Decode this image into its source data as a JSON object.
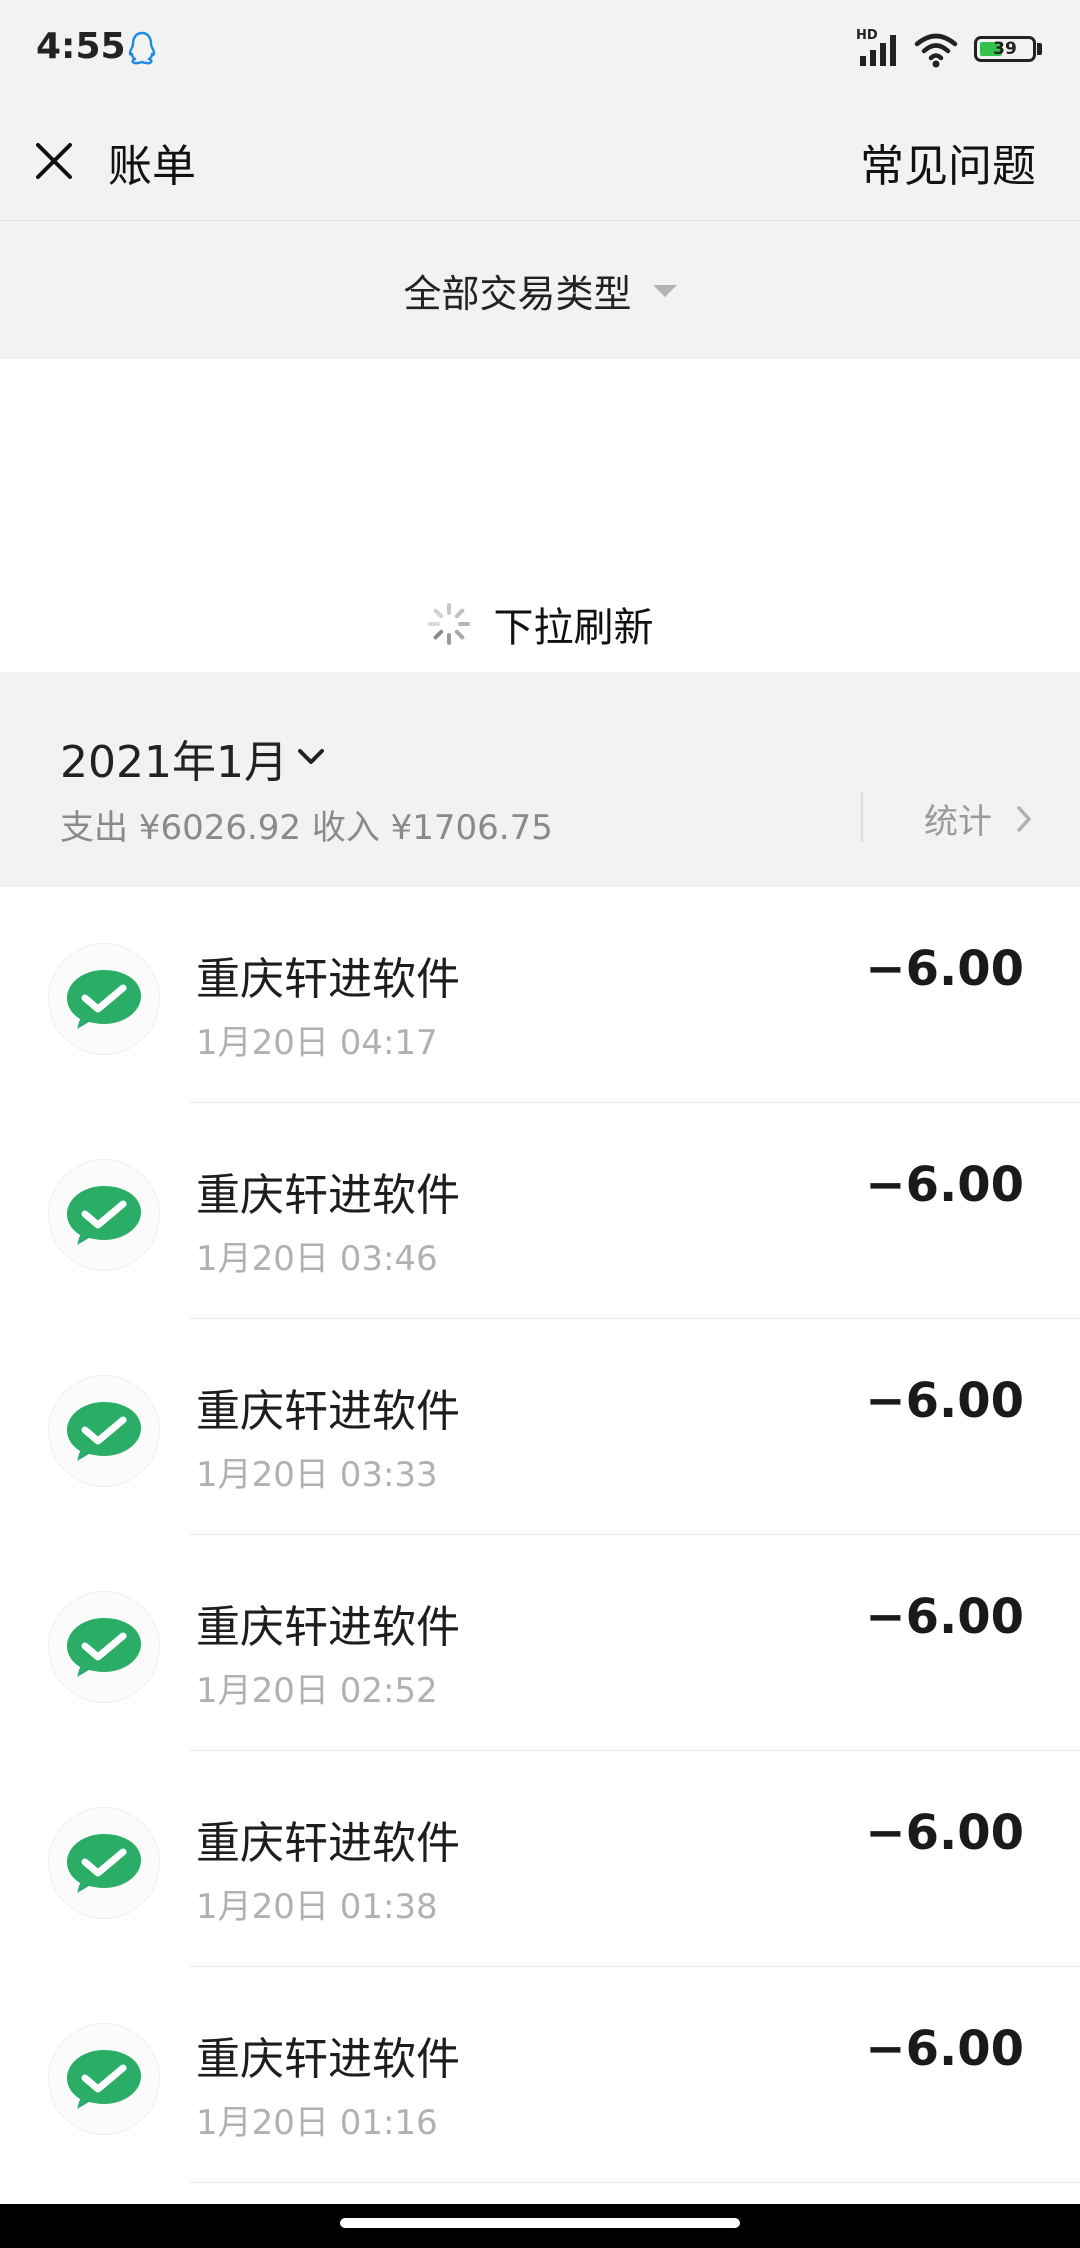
{
  "status_bar": {
    "time": "4:55",
    "hd_label": "HD",
    "battery": "39",
    "battery_level": 0.39,
    "battery_color": "#33c24d",
    "icons": [
      "qq-icon",
      "signal-icon",
      "wifi-icon",
      "battery-icon"
    ]
  },
  "header": {
    "title": "账单",
    "faq_label": "常见问题",
    "close_icon": "close-icon"
  },
  "filter": {
    "label": "全部交易类型",
    "caret_icon": "caret-down-icon"
  },
  "refresh": {
    "text": "下拉刷新",
    "spinner_icon": "loading-spinner-icon"
  },
  "month": {
    "title": "2021年1月",
    "summary": "支出 ¥6026.92 收入 ¥1706.75",
    "stats_label": "统计",
    "chevron_icon": "chevron-down-icon"
  },
  "transactions": [
    {
      "name": "重庆轩进软件",
      "time": "1月20日 04:17",
      "amount": "−6.00"
    },
    {
      "name": "重庆轩进软件",
      "time": "1月20日 03:46",
      "amount": "−6.00"
    },
    {
      "name": "重庆轩进软件",
      "time": "1月20日 03:33",
      "amount": "−6.00"
    },
    {
      "name": "重庆轩进软件",
      "time": "1月20日 02:52",
      "amount": "−6.00"
    },
    {
      "name": "重庆轩进软件",
      "time": "1月20日 01:38",
      "amount": "−6.00"
    },
    {
      "name": "重庆轩进软件",
      "time": "1月20日 01:16",
      "amount": "−6.00"
    }
  ],
  "colors": {
    "wechat_green": "#2aae67",
    "background_gray": "#f2f2f2",
    "secondary_text": "#b1b1b1"
  }
}
